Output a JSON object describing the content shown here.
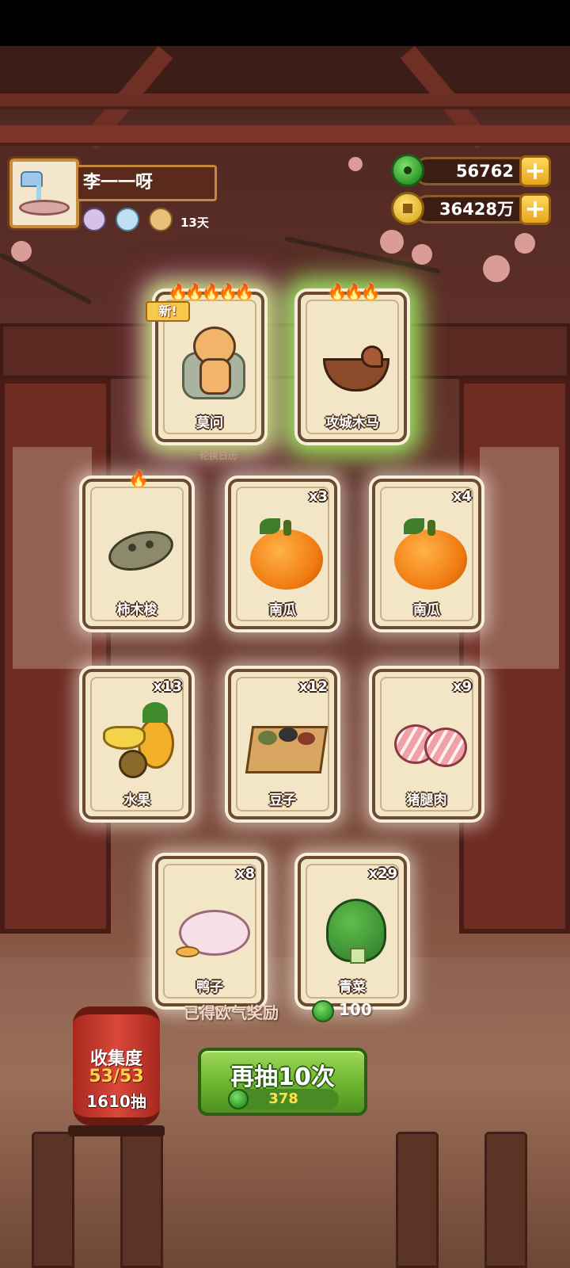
{
  "player": {
    "name": "李一一呀",
    "days": "13天"
  },
  "currency": {
    "jade": "56762",
    "coins": "36428万"
  },
  "featured": [
    {
      "name": "莫问",
      "badge": "新!",
      "flames": "🔥🔥🔥🔥🔥"
    },
    {
      "name": "攻城木马",
      "flames": "🔥🔥🔥"
    }
  ],
  "featured_caption": "轮换日历",
  "cards": [
    {
      "name": "柿木梭",
      "count": "",
      "flames": "🔥"
    },
    {
      "name": "南瓜",
      "count": "x3"
    },
    {
      "name": "南瓜",
      "count": "x4"
    },
    {
      "name": "水果",
      "count": "x13"
    },
    {
      "name": "豆子",
      "count": "x12"
    },
    {
      "name": "猪腿肉",
      "count": "x9"
    },
    {
      "name": "鸭子",
      "count": "x8"
    },
    {
      "name": "青菜",
      "count": "x29"
    }
  ],
  "reward": {
    "label": "已得欧气奖励",
    "amount": "100"
  },
  "collection": {
    "label": "收集度",
    "progress": "53/53",
    "draws": "1610抽"
  },
  "draw_button": {
    "label": "再抽10次",
    "cost": "378"
  }
}
